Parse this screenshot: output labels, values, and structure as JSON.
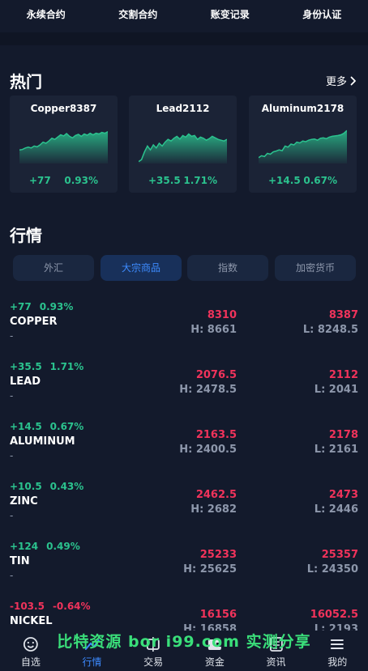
{
  "top_nav": [
    "永续合约",
    "交割合约",
    "账变记录",
    "身份认证"
  ],
  "hot": {
    "title": "热门",
    "more_label": "更多"
  },
  "hot_cards": [
    {
      "name": "Copper8387",
      "change": "+77",
      "percent": "0.93%",
      "spark": [
        0.35,
        0.36,
        0.4,
        0.42,
        0.4,
        0.45,
        0.43,
        0.48,
        0.55,
        0.52,
        0.58,
        0.65,
        0.62,
        0.68,
        0.74,
        0.71,
        0.77,
        0.7,
        0.66,
        0.72,
        0.75,
        0.7,
        0.76,
        0.73,
        0.78,
        0.74,
        0.78,
        0.76,
        0.8,
        0.78,
        0.82
      ]
    },
    {
      "name": "Lead2112",
      "change": "+35.5",
      "percent": "1.71%",
      "spark": [
        0.05,
        0.1,
        0.3,
        0.45,
        0.35,
        0.48,
        0.4,
        0.52,
        0.45,
        0.55,
        0.62,
        0.58,
        0.65,
        0.7,
        0.63,
        0.72,
        0.68,
        0.76,
        0.7,
        0.72,
        0.62,
        0.68,
        0.65,
        0.6,
        0.64,
        0.7,
        0.66,
        0.62,
        0.6,
        0.58,
        0.62
      ]
    },
    {
      "name": "Aluminum2178",
      "change": "+14.5",
      "percent": "0.67%",
      "spark": [
        0.15,
        0.2,
        0.18,
        0.26,
        0.24,
        0.3,
        0.32,
        0.35,
        0.33,
        0.45,
        0.42,
        0.5,
        0.48,
        0.55,
        0.53,
        0.58,
        0.56,
        0.6,
        0.62,
        0.63,
        0.6,
        0.65,
        0.66,
        0.64,
        0.68,
        0.7,
        0.71,
        0.72,
        0.74,
        0.78,
        0.85
      ]
    }
  ],
  "market": {
    "title": "行情"
  },
  "market_tabs": [
    {
      "label": "外汇",
      "active": false
    },
    {
      "label": "大宗商品",
      "active": true
    },
    {
      "label": "指数",
      "active": false
    },
    {
      "label": "加密货币",
      "active": false
    }
  ],
  "rows": [
    {
      "change": "+77",
      "percent": "0.93%",
      "direction": "up",
      "symbol": "COPPER",
      "sub": "-",
      "price_a": "8310",
      "high": "H: 8661",
      "price_b": "8387",
      "low": "L: 8248.5"
    },
    {
      "change": "+35.5",
      "percent": "1.71%",
      "direction": "up",
      "symbol": "LEAD",
      "sub": "-",
      "price_a": "2076.5",
      "high": "H: 2478.5",
      "price_b": "2112",
      "low": "L: 2041"
    },
    {
      "change": "+14.5",
      "percent": "0.67%",
      "direction": "up",
      "symbol": "ALUMINUM",
      "sub": "-",
      "price_a": "2163.5",
      "high": "H: 2400.5",
      "price_b": "2178",
      "low": "L: 2161"
    },
    {
      "change": "+10.5",
      "percent": "0.43%",
      "direction": "up",
      "symbol": "ZINC",
      "sub": "-",
      "price_a": "2462.5",
      "high": "H: 2682",
      "price_b": "2473",
      "low": "L: 2446"
    },
    {
      "change": "+124",
      "percent": "0.49%",
      "direction": "up",
      "symbol": "TIN",
      "sub": "-",
      "price_a": "25233",
      "high": "H: 25625",
      "price_b": "25357",
      "low": "L: 24350"
    },
    {
      "change": "-103.5",
      "percent": "-0.64%",
      "direction": "down",
      "symbol": "NICKEL",
      "sub": "-",
      "price_a": "16156",
      "high": "H: 16858",
      "price_b": "16052.5",
      "low": "L: 2193"
    }
  ],
  "bottom_nav": [
    {
      "label": "自选",
      "icon": "smile-icon",
      "active": false
    },
    {
      "label": "行情",
      "icon": "market-icon",
      "active": true
    },
    {
      "label": "交易",
      "icon": "trade-icon",
      "active": false
    },
    {
      "label": "资金",
      "icon": "wallet-icon",
      "active": false
    },
    {
      "label": "资讯",
      "icon": "news-icon",
      "active": false
    },
    {
      "label": "我的",
      "icon": "menu-icon",
      "active": false
    }
  ],
  "watermark": "比特资源 bor i99.com 实测分享",
  "colors": {
    "up": "#2bc28e",
    "down": "#f0335b",
    "accent": "#3d8bff",
    "background": "#131a2c",
    "card": "#1b2336"
  }
}
